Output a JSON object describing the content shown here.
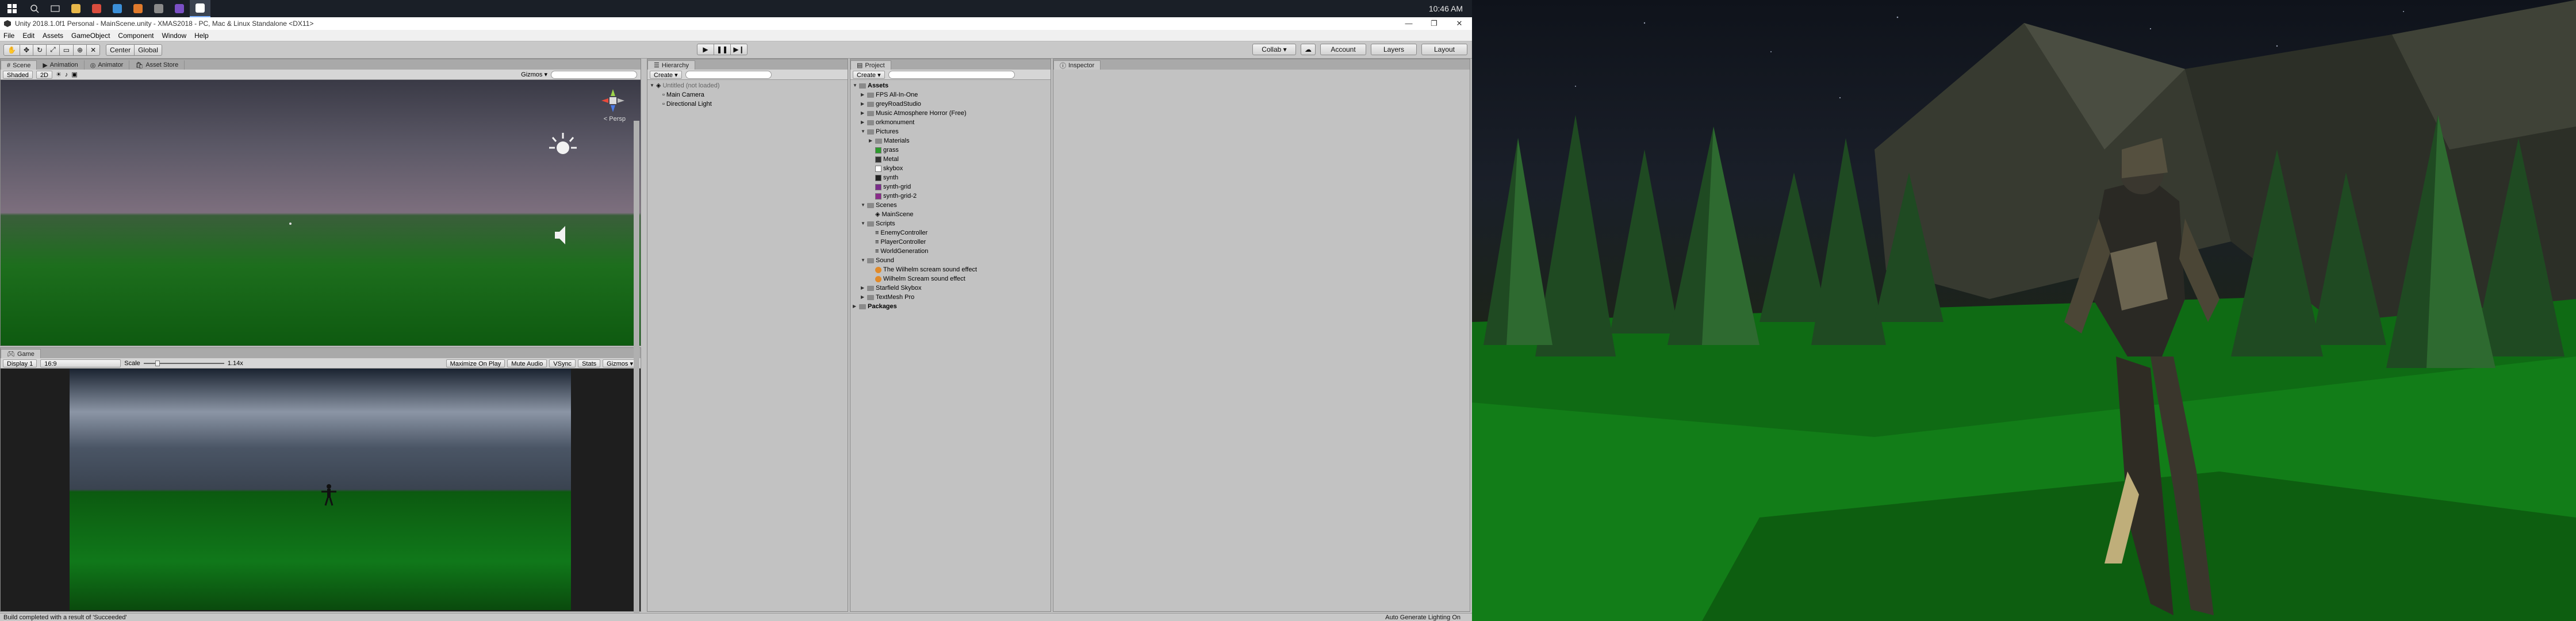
{
  "taskbar": {
    "clock": "10:46 AM",
    "apps": [
      {
        "icon": "file-explorer-icon",
        "color": "#e8b84a"
      },
      {
        "icon": "chrome-icon",
        "color": "#d94c3d"
      },
      {
        "icon": "edge-icon",
        "color": "#3b8fd8"
      },
      {
        "icon": "media-icon",
        "color": "#e07a2c"
      },
      {
        "icon": "terminal-icon",
        "color": "#8a8a8a"
      },
      {
        "icon": "visual-studio-icon",
        "color": "#7a4fc4"
      },
      {
        "icon": "unity-icon",
        "color": "#ffffff"
      }
    ]
  },
  "window": {
    "title": "Unity 2018.1.0f1 Personal - MainScene.unity - XMAS2018 - PC, Mac & Linux Standalone <DX11>",
    "min": "—",
    "max": "❐",
    "close": "✕"
  },
  "menu": [
    "File",
    "Edit",
    "Assets",
    "GameObject",
    "Component",
    "Window",
    "Help"
  ],
  "toolbar": {
    "pivot": "Center",
    "space": "Global",
    "collab": "Collab ▾",
    "account": "Account",
    "layers": "Layers",
    "layout": "Layout"
  },
  "scene_panel": {
    "tabs": [
      "Scene",
      "Animation",
      "Animator",
      "Asset Store"
    ],
    "shading": "Shaded",
    "mode_2d": "2D",
    "gizmos": "Gizmos ▾",
    "search_placeholder": "All",
    "persp_label": "< Persp"
  },
  "game_panel": {
    "tab": "Game",
    "display": "Display 1",
    "aspect": "16:9",
    "scale_label": "Scale",
    "scale_value": "1.14x",
    "toggles": [
      "Maximize On Play",
      "Mute Audio",
      "VSync",
      "Stats",
      "Gizmos ▾"
    ]
  },
  "hierarchy": {
    "tab": "Hierarchy",
    "create": "Create ▾",
    "search_placeholder": "All",
    "scene": "Untitled (not loaded)",
    "items": [
      "Main Camera",
      "Directional Light"
    ]
  },
  "project": {
    "tab": "Project",
    "create": "Create ▾",
    "tree": [
      {
        "label": "Assets",
        "level": 0,
        "kind": "folder",
        "open": true,
        "bold": true
      },
      {
        "label": "FPS All-In-One",
        "level": 1,
        "kind": "folder"
      },
      {
        "label": "greyRoadStudio",
        "level": 1,
        "kind": "folder"
      },
      {
        "label": "Music Atmosphere Horror (Free)",
        "level": 1,
        "kind": "folder"
      },
      {
        "label": "orkmonument",
        "level": 1,
        "kind": "folder"
      },
      {
        "label": "Pictures",
        "level": 1,
        "kind": "folder",
        "open": true
      },
      {
        "label": "Materials",
        "level": 2,
        "kind": "folder"
      },
      {
        "label": "grass",
        "level": 2,
        "kind": "swatch",
        "color": "#2c9a2c"
      },
      {
        "label": "Metal",
        "level": 2,
        "kind": "swatch",
        "color": "#333333"
      },
      {
        "label": "skybox",
        "level": 2,
        "kind": "swatch",
        "color": "#ffffff"
      },
      {
        "label": "synth",
        "level": 2,
        "kind": "swatch",
        "color": "#222222"
      },
      {
        "label": "synth-grid",
        "level": 2,
        "kind": "swatch",
        "color": "#7a2c8a"
      },
      {
        "label": "synth-grid-2",
        "level": 2,
        "kind": "swatch",
        "color": "#8a2c8a"
      },
      {
        "label": "Scenes",
        "level": 1,
        "kind": "folder",
        "open": true
      },
      {
        "label": "MainScene",
        "level": 2,
        "kind": "scene"
      },
      {
        "label": "Scripts",
        "level": 1,
        "kind": "folder",
        "open": true
      },
      {
        "label": "EnemyController",
        "level": 2,
        "kind": "script"
      },
      {
        "label": "PlayerController",
        "level": 2,
        "kind": "script"
      },
      {
        "label": "WorldGeneration",
        "level": 2,
        "kind": "script"
      },
      {
        "label": "Sound",
        "level": 1,
        "kind": "folder",
        "open": true
      },
      {
        "label": "The Wilhelm scream sound effect",
        "level": 2,
        "kind": "audio"
      },
      {
        "label": "Wilhelm Scream sound effect",
        "level": 2,
        "kind": "audio"
      },
      {
        "label": "Starfield Skybox",
        "level": 1,
        "kind": "folder"
      },
      {
        "label": "TextMesh Pro",
        "level": 1,
        "kind": "folder"
      },
      {
        "label": "Packages",
        "level": 0,
        "kind": "folder",
        "bold": true
      }
    ]
  },
  "inspector": {
    "tab": "Inspector"
  },
  "status": {
    "message": "Build completed with a result of 'Succeeded'",
    "right": "Auto Generate Lighting On"
  }
}
